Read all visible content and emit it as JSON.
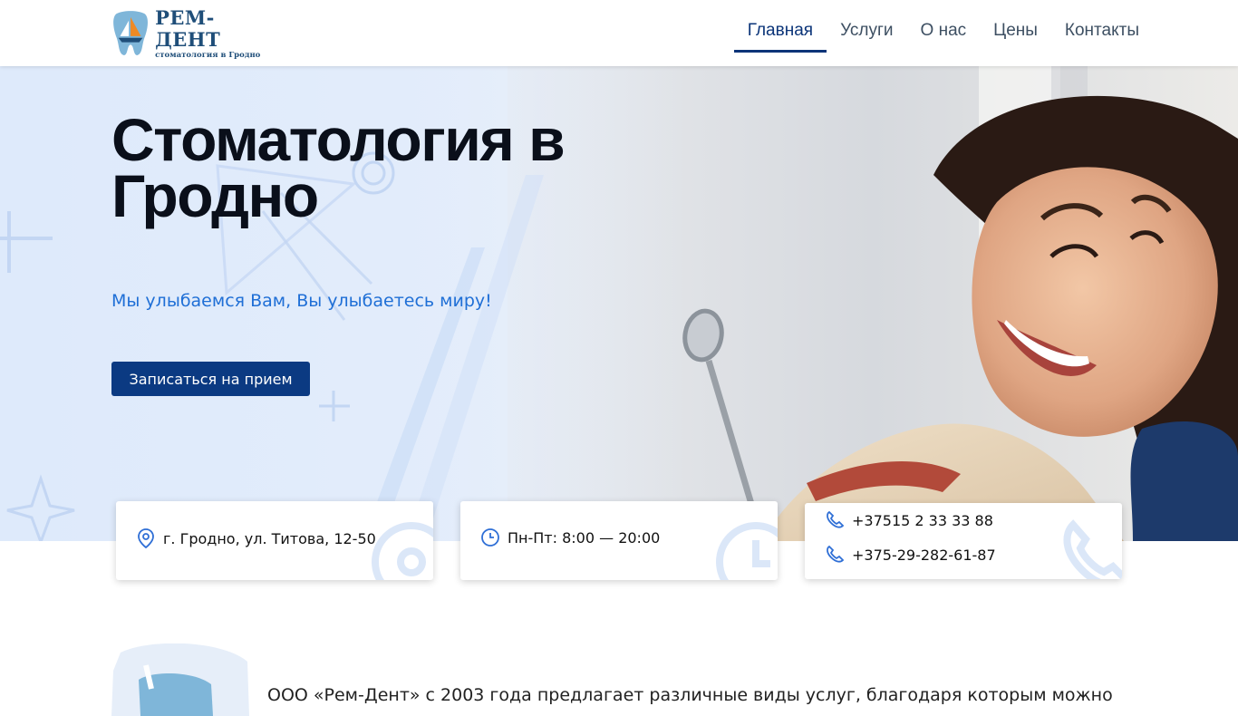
{
  "header": {
    "logo": {
      "title": "РЕМ-ДЕНТ",
      "subtitle": "стоматология в Гродно"
    },
    "nav": [
      {
        "label": "Главная",
        "active": true
      },
      {
        "label": "Услуги",
        "active": false
      },
      {
        "label": "О нас",
        "active": false
      },
      {
        "label": "Цены",
        "active": false
      },
      {
        "label": "Контакты",
        "active": false
      }
    ]
  },
  "hero": {
    "title": "Стоматология в Гродно",
    "slogan": "Мы улыбаемся Вам, Вы улыбаетесь миру!",
    "cta_label": "Записаться на прием"
  },
  "info_cards": {
    "address": {
      "icon": "location-pin-icon",
      "text": "г. Гродно, ул. Титова, 12-50"
    },
    "hours": {
      "icon": "clock-icon",
      "text": "Пн-Пт: 8:00 — 20:00"
    },
    "phones": {
      "icon": "phone-icon",
      "phone_1": "+37515 2 33 33 88",
      "phone_2": "+375-29-282-61-87"
    }
  },
  "about": {
    "text": "ООО «Рем-Дент» с 2003 года предлагает различные виды услуг, благодаря которым можно"
  },
  "colors": {
    "accent_dark": "#0b3478",
    "accent_blue": "#1f6fd6",
    "button_bg": "#0b3a82",
    "icon_blue": "#2f6fd6"
  }
}
